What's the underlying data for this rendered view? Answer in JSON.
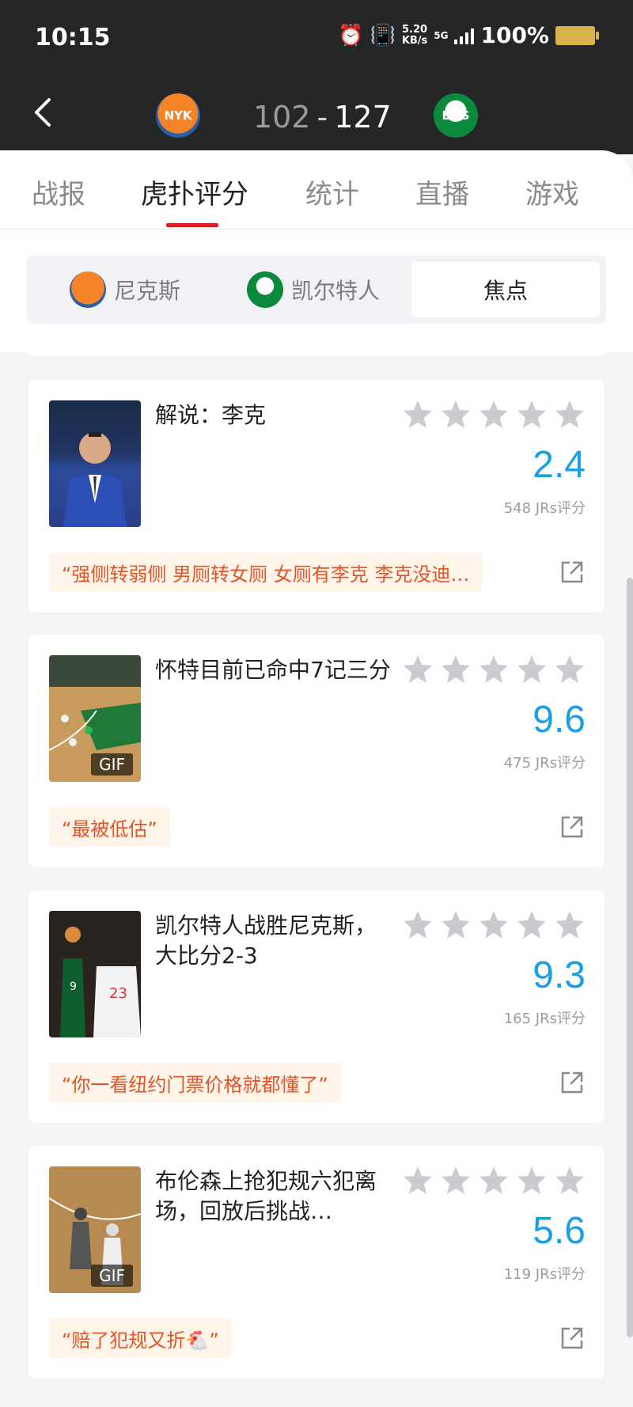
{
  "status": {
    "time": "10:15",
    "net_speed": "5.20",
    "net_unit": "KB/s",
    "network": "5G",
    "battery": "100%"
  },
  "header": {
    "home_abbr": "NYK",
    "away_abbr": "BOS",
    "home_score": "102",
    "separator": "-",
    "away_score": "127"
  },
  "tabs": [
    "战报",
    "虎扑评分",
    "统计",
    "直播",
    "游戏"
  ],
  "segments": {
    "home": "尼克斯",
    "away": "凯尔特人",
    "focus": "焦点"
  },
  "cards": [
    {
      "title": "解说：李克",
      "rating": "2.4",
      "votes": "548 JRs评分",
      "quote": "“强侧转弱侧 男厕转女厕 女厕有李克 李克没迪…",
      "gif": ""
    },
    {
      "title": "怀特目前已命中7记三分",
      "rating": "9.6",
      "votes": "475 JRs评分",
      "quote": "“最被低估”",
      "gif": "GIF"
    },
    {
      "title": "凯尔特人战胜尼克斯，大比分2-3",
      "rating": "9.3",
      "votes": "165 JRs评分",
      "quote": "“你一看纽约门票价格就都懂了”",
      "gif": ""
    },
    {
      "title": "布伦森上抢犯规六犯离场，回放后挑战…",
      "rating": "5.6",
      "votes": "119 JRs评分",
      "quote": "“赔了犯规又折🐔”",
      "gif": "GIF"
    }
  ],
  "colors": {
    "accent": "#e02020",
    "rating": "#1a9fe0",
    "quote_text": "#e0552a",
    "quote_bg": "#fff4e8"
  }
}
